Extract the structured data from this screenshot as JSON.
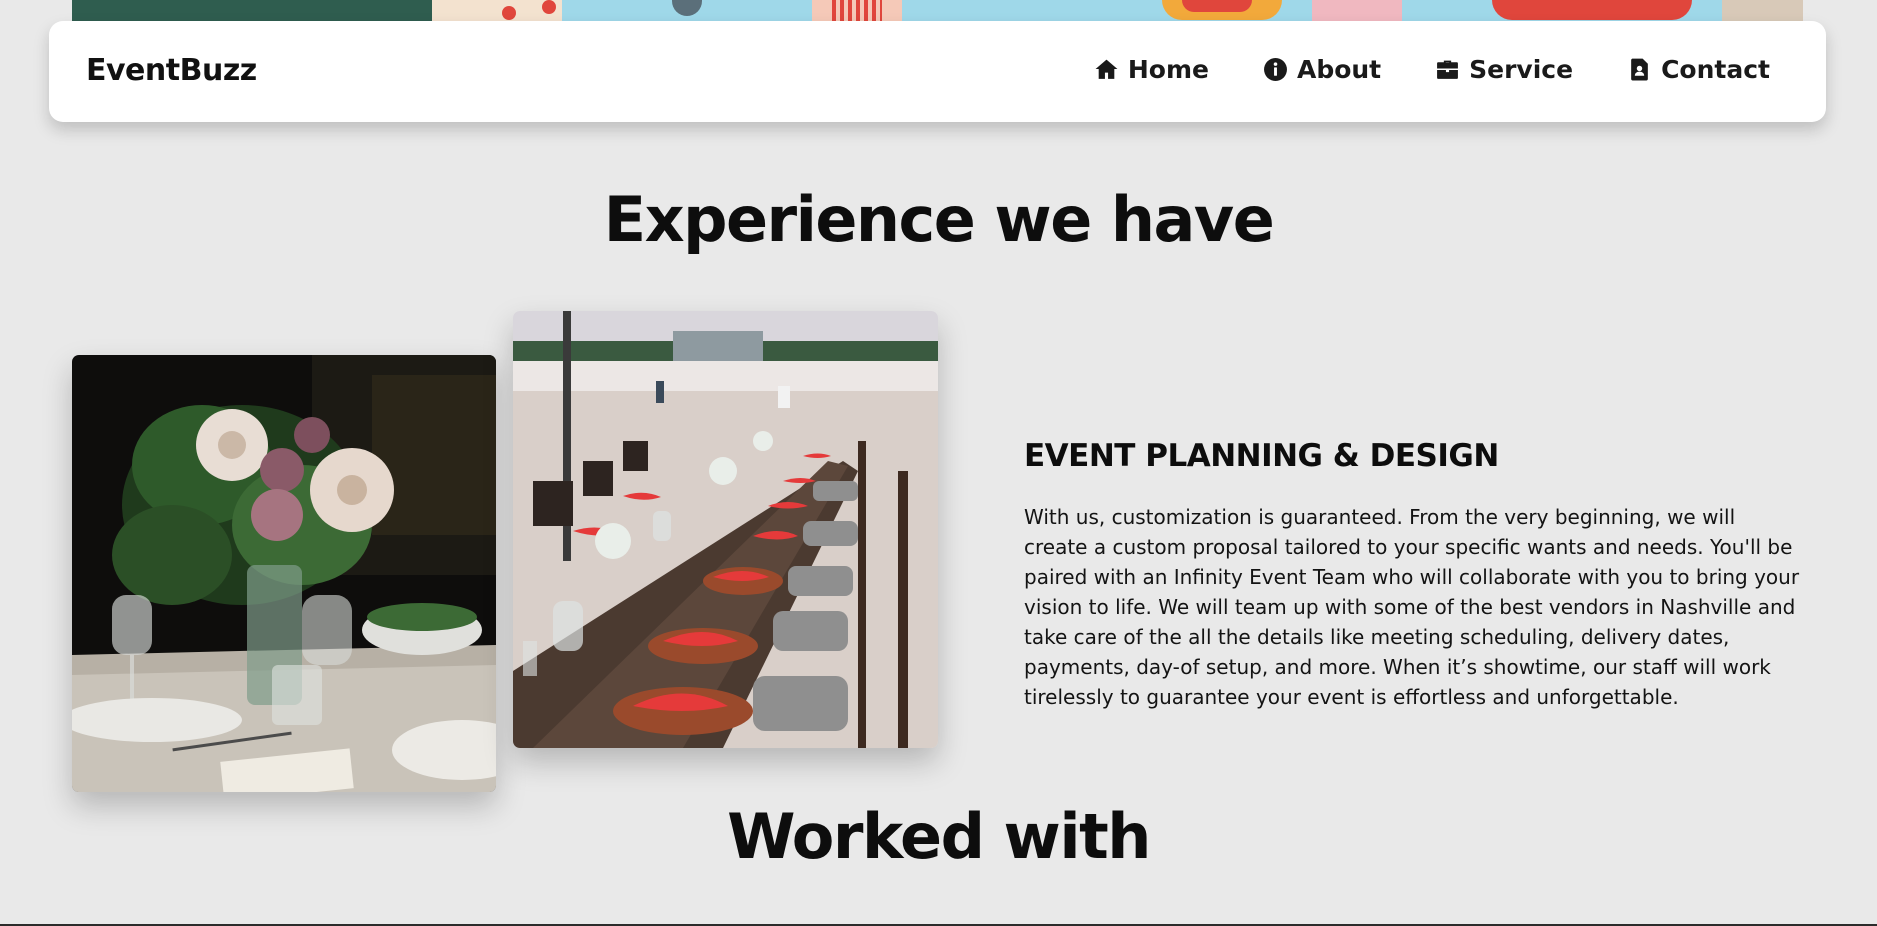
{
  "navbar": {
    "brand": "EventBuzz",
    "links": [
      {
        "label": "Home",
        "icon": "home-icon"
      },
      {
        "label": "About",
        "icon": "info-icon"
      },
      {
        "label": "Service",
        "icon": "briefcase-icon"
      },
      {
        "label": "Contact",
        "icon": "contact-card-icon"
      }
    ]
  },
  "experience": {
    "title": "Experience we have",
    "heading": "EVENT PLANNING & DESIGN",
    "body": "With us, customization is guaranteed. From the very beginning, we will create a custom proposal tailored to your specific wants and needs. You'll be paired with an Infinity Event Team who will collaborate with you to bring your vision to life. We will team up with some of the best vendors in Nashville and take care of the all the details like meeting scheduling, delivery dates, payments, day-of setup, and more. When it’s showtime, our staff will work tirelessly to guarantee your event is effortless and unforgettable."
  },
  "worked_with": {
    "title": "Worked with"
  },
  "colors": {
    "background": "#e9e9e9",
    "navbar": "#ffffff",
    "text": "#111111",
    "accent_red": "#e0463c"
  }
}
